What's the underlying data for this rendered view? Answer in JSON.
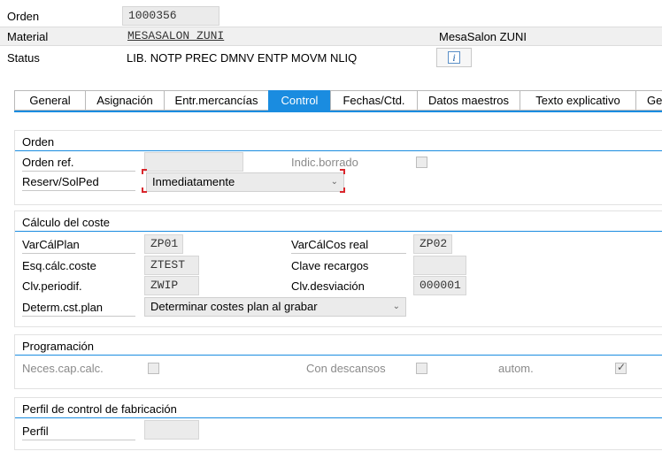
{
  "header": {
    "order_label": "Orden",
    "order_value": "1000356",
    "material_label": "Material",
    "material_value": "MESASALON ZUNI",
    "material_desc": "MesaSalon ZUNI",
    "status_label": "Status",
    "status_value": "LIB. NOTP PREC DMNV ENTP MOVM NLIQ",
    "info_icon": "info-icon"
  },
  "tabs": [
    {
      "label": "General",
      "active": false
    },
    {
      "label": "Asignación",
      "active": false
    },
    {
      "label": "Entr.mercancías",
      "active": false
    },
    {
      "label": "Control",
      "active": true
    },
    {
      "label": "Fechas/Ctd.",
      "active": false
    },
    {
      "label": "Datos maestros",
      "active": false
    },
    {
      "label": "Texto explicativo",
      "active": false
    },
    {
      "label": "Ge",
      "active": false
    }
  ],
  "orden_group": {
    "title": "Orden",
    "orden_ref_label": "Orden ref.",
    "orden_ref_value": "",
    "indic_borrado_label": "Indic.borrado",
    "indic_borrado_checked": false,
    "reserv_label": "Reserv/SolPed",
    "reserv_value": "Inmediatamente"
  },
  "calculo_group": {
    "title": "Cálculo del coste",
    "varcalplan_label": "VarCálPlan",
    "varcalplan_value": "ZP01",
    "varcalcos_label": "VarCálCos real",
    "varcalcos_value": "ZP02",
    "esq_label": "Esq.cálc.coste",
    "esq_value": "ZTEST",
    "clave_label": "Clave recargos",
    "clave_value": "",
    "clv_periodif_label": "Clv.periodif.",
    "clv_periodif_value": "ZWIP",
    "clv_desviacion_label": "Clv.desviación",
    "clv_desviacion_value": "000001",
    "determ_label": "Determ.cst.plan",
    "determ_value": "Determinar costes plan al grabar"
  },
  "programacion_group": {
    "title": "Programación",
    "neces_label": "Neces.cap.calc.",
    "neces_checked": false,
    "descansos_label": "Con descansos",
    "descansos_checked": false,
    "autom_label": "autom.",
    "autom_checked": true
  },
  "perfil_group": {
    "title": "Perfil de control de fabricación",
    "perfil_label": "Perfil",
    "perfil_value": ""
  }
}
